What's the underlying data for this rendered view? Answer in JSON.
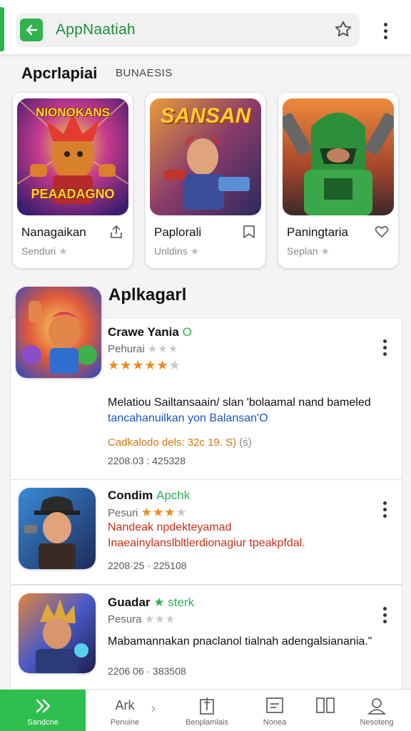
{
  "header": {
    "title": "AppNaatiah",
    "accent": "#2fb24f"
  },
  "featured": {
    "title": "Apcrlapiai",
    "subtitle": "BUNAESIS",
    "cards": [
      {
        "art_title": "NIONOKANS",
        "art_sub": "PEAADAGNO",
        "name": "Nanagaikan",
        "subtitle": "Senduri",
        "icon": "share-icon"
      },
      {
        "art_title": "SANSAN",
        "name": "Paplorali",
        "subtitle": "Unldins",
        "icon": "bookmark-icon"
      },
      {
        "name": "Paningtaria",
        "subtitle": "Seplan",
        "icon": "heart-icon"
      }
    ]
  },
  "list": {
    "title": "Aplkagarl",
    "items": [
      {
        "title": "Crawe Yania",
        "title_accent": "O",
        "publisher": "Pehurai",
        "pub_stars": "★★★",
        "rating": "★★★★★",
        "rating_off": "★",
        "desc_line1": "Melatiou Sailtansaain/ slan 'bolaamal nand bameled",
        "desc_line2": "tancahanuilkan yon Balansan'O",
        "desc_line2_color": "#1a57c0",
        "price": "Cadkalodo dels: 32c 19. S)",
        "price_suffix": "(ṡ)",
        "date": "2208.03 : 425328"
      },
      {
        "title": "Condim",
        "title_accent": "Apchk",
        "publisher": "Pesuri",
        "rating": "★★★",
        "rating_off": "★",
        "desc_line1": "Nandeak npdekteyamad",
        "desc_line2": "Inaeainylanslbltlerdionagiur tpeakpfdal.",
        "date": "2208·25 · 225108"
      },
      {
        "title": "Guadar",
        "title_accent": "★ sterk",
        "publisher": "Pesura",
        "pub_stars": "★★★",
        "desc_line1": "Mabamannakan pnaclanol tialnah adengalsianania.\"",
        "date": "2206 06 · 383508"
      }
    ]
  },
  "bottom_nav": [
    {
      "label": "Sandcne",
      "icon": "chevrons-icon"
    },
    {
      "label": "Penuine",
      "icon": "apps-text-icon",
      "icon_text": "Ark"
    },
    {
      "label": "Benplamlais",
      "icon": "book-icon"
    },
    {
      "label": "Nonea",
      "icon": "note-icon"
    },
    {
      "label": "",
      "icon": "columns-icon"
    },
    {
      "label": "Nesoteng",
      "icon": "user-icon"
    }
  ]
}
